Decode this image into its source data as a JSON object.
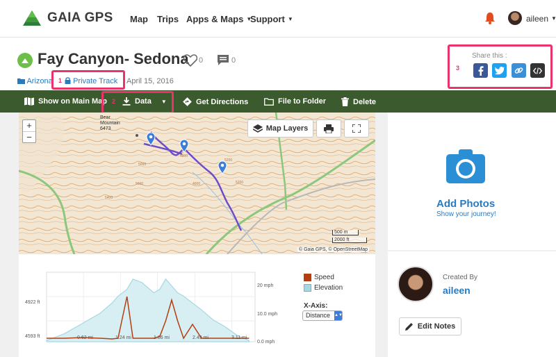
{
  "nav": {
    "brand": "GAIA GPS",
    "items": [
      {
        "label": "Map"
      },
      {
        "label": "Trips"
      },
      {
        "label": "Apps & Maps"
      },
      {
        "label": "Support"
      }
    ],
    "username": "aileen"
  },
  "track": {
    "title": "Fay Canyon- Sedona",
    "likes": "0",
    "comments": "0",
    "folder": "Arizona",
    "privacy": "Private Track",
    "date": "April 15, 2016"
  },
  "share": {
    "label": "Share this :",
    "buttons": [
      {
        "icon": "facebook-icon",
        "color": "#3b5998"
      },
      {
        "icon": "twitter-icon",
        "color": "#1da1f2"
      },
      {
        "icon": "link-icon",
        "color": "#3b8fd8"
      },
      {
        "icon": "embed-code-icon",
        "color": "#333333"
      }
    ]
  },
  "toolbar": {
    "show_on_map": "Show on Main Map",
    "data": "Data",
    "directions": "Get Directions",
    "file_to_folder": "File to Folder",
    "delete": "Delete"
  },
  "annotations": [
    "1",
    "2",
    "3"
  ],
  "map": {
    "layers_button": "Map Layers",
    "peak_name": "Bear Mountain",
    "peak_elev": "6473",
    "scale_m": "500 m",
    "scale_ft": "2000 ft",
    "attribution": "© Gaia GPS, © OpenStreetMap",
    "contour_labels": [
      "5000",
      "5200",
      "4800",
      "4600",
      "5400",
      "5600",
      "5200"
    ]
  },
  "chart_data": {
    "type": "line",
    "x": {
      "label": "",
      "ticks": [
        "0.62 mi",
        "1.24 mi",
        "1.86 mi",
        "2.49 mi",
        "3.11 mi"
      ]
    },
    "y_left": {
      "ticks": [
        "4922 ft",
        "4593 ft"
      ],
      "range": [
        4593,
        5000
      ]
    },
    "y_right": {
      "ticks": [
        "20 mph",
        "10.0 mph",
        "0.0 mph"
      ],
      "range": [
        0,
        20
      ]
    },
    "series": [
      {
        "name": "Speed",
        "color": "#b33e0f",
        "axis": "right",
        "x": [
          0,
          0.3,
          0.6,
          0.9,
          1.1,
          1.2,
          1.35,
          1.45,
          1.6,
          1.8,
          1.9,
          2.0,
          2.1,
          2.2,
          2.3,
          2.45,
          2.6,
          2.8,
          3.0,
          3.2,
          3.4
        ],
        "values": [
          1,
          1,
          1.2,
          1,
          0.8,
          1,
          13,
          1,
          1,
          1,
          1.5,
          6,
          12,
          6,
          1,
          5,
          1,
          1,
          1,
          1,
          1
        ]
      },
      {
        "name": "Elevation",
        "color": "#a6d8e2",
        "axis": "left",
        "x": [
          0,
          0.3,
          0.6,
          0.9,
          1.1,
          1.2,
          1.35,
          1.45,
          1.6,
          1.8,
          1.9,
          2.0,
          2.1,
          2.2,
          2.3,
          2.45,
          2.6,
          2.8,
          3.0,
          3.2,
          3.4
        ],
        "values": [
          4600,
          4640,
          4700,
          4760,
          4820,
          4860,
          4900,
          4960,
          4940,
          4880,
          4900,
          4960,
          4920,
          4880,
          4860,
          4820,
          4780,
          4720,
          4680,
          4630,
          4600
        ]
      }
    ],
    "legend_position": "right",
    "x_axis_selector_label": "X-Axis:",
    "x_axis_selected": "Distance"
  },
  "photos": {
    "title": "Add Photos",
    "subtitle": "Show your journey!"
  },
  "creator": {
    "label": "Created By",
    "name": "aileen",
    "edit_button": "Edit Notes"
  }
}
